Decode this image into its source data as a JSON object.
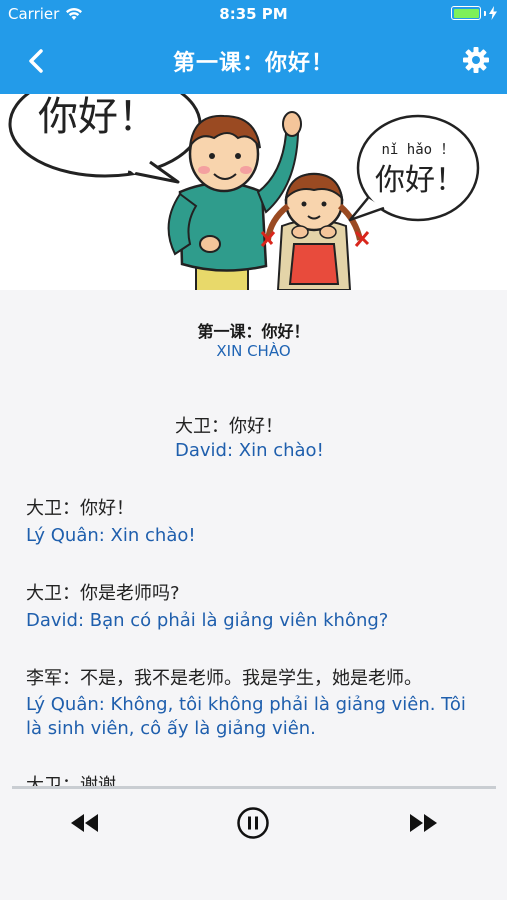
{
  "status": {
    "carrier": "Carrier",
    "time": "8:35 PM"
  },
  "nav": {
    "title": "第一课：你好！",
    "back_icon": "chevron-left-icon",
    "settings_icon": "gear-icon"
  },
  "illustration": {
    "bubble_left": "你好！",
    "bubble_right_pinyin": "nǐ hǎo ！",
    "bubble_right_text": "你好！"
  },
  "lesson": {
    "title": "第一课：你好！",
    "subtitle": "XIN CHÀO"
  },
  "dialogue": [
    {
      "zh": "大卫：你好！",
      "vi": "David: Xin chào!"
    },
    {
      "zh": "大卫：你好！",
      "vi": "Lý Quân: Xin chào!"
    },
    {
      "zh": "大卫：你是老师吗?",
      "vi": "David: Bạn có phải là giảng viên không?"
    },
    {
      "zh": "李军：不是，我不是老师。我是学生，她是老师。",
      "vi": "Lý Quân: Không, tôi không phải là giảng viên. Tôi là sinh viên, cô ấy là giảng viên."
    },
    {
      "zh": "大卫：谢谢"
    }
  ],
  "player": {
    "rewind_icon": "rewind-icon",
    "pause_icon": "pause-circle-icon",
    "forward_icon": "fast-forward-icon"
  },
  "colors": {
    "header": "#239be9",
    "translation": "#1f5fad",
    "background": "#f5f5f7"
  }
}
